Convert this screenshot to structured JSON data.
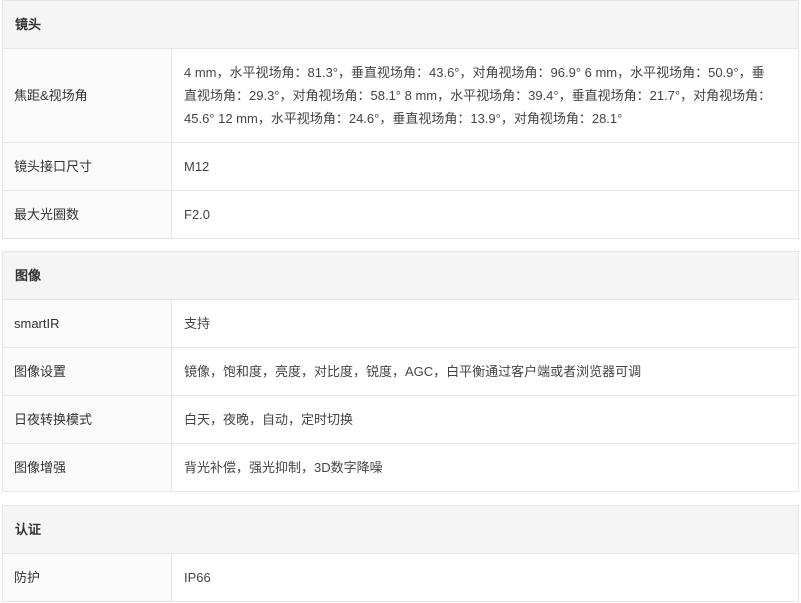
{
  "sections": [
    {
      "title": "镜头",
      "rows": [
        {
          "label": "焦距&视场角",
          "value": "4 mm，水平视场角：81.3°，垂直视场角：43.6°，对角视场角：96.9° 6 mm，水平视场角：50.9°，垂直视场角：29.3°，对角视场角：58.1° 8 mm，水平视场角：39.4°，垂直视场角：21.7°，对角视场角：45.6° 12 mm，水平视场角：24.6°，垂直视场角：13.9°，对角视场角：28.1°"
        },
        {
          "label": "镜头接口尺寸",
          "value": "M12"
        },
        {
          "label": "最大光圈数",
          "value": "F2.0"
        }
      ]
    },
    {
      "title": "图像",
      "rows": [
        {
          "label": "smartIR",
          "value": "支持"
        },
        {
          "label": "图像设置",
          "value": "镜像，饱和度，亮度，对比度，锐度，AGC，白平衡通过客户端或者浏览器可调"
        },
        {
          "label": "日夜转换模式",
          "value": "白天，夜晚，自动，定时切换"
        },
        {
          "label": "图像增强",
          "value": "背光补偿，强光抑制，3D数字降噪"
        }
      ]
    },
    {
      "title": "认证",
      "rows": [
        {
          "label": "防护",
          "value": "IP66"
        }
      ]
    }
  ]
}
